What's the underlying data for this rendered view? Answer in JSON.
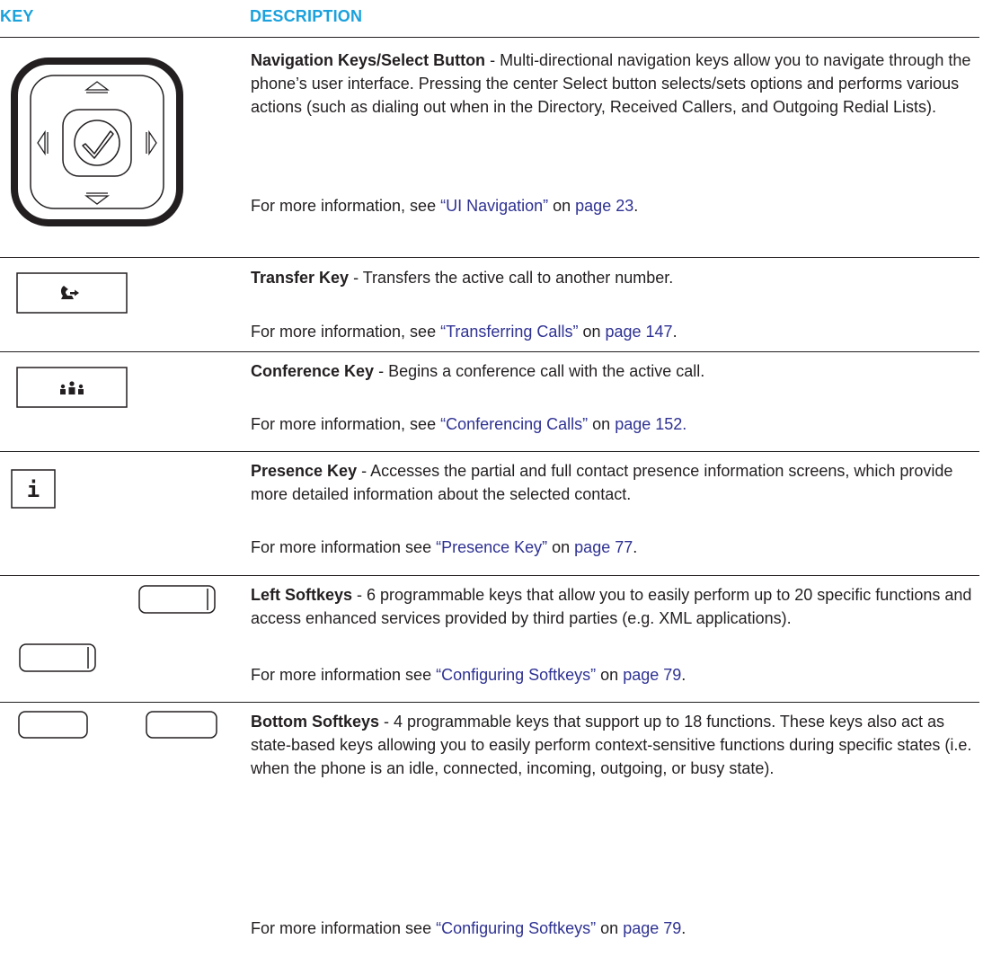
{
  "header": {
    "key_label": "KEY",
    "description_label": "DESCRIPTION"
  },
  "colors": {
    "header_blue": "#1ba1dc",
    "link_blue": "#2e3192",
    "text": "#231f20"
  },
  "rows": [
    {
      "icon": "navigation-keys-select-button-icon",
      "title": "Navigation Keys/Select Button",
      "sep": " - ",
      "description": "Multi-directional navigation keys allow you to navigate through the phone’s user interface. Pressing the center Select button selects/sets options and performs various actions (such as dialing out when in the Directory, Received Callers, and Outgoing Redial Lists).",
      "more_prefix": "For more information, see ",
      "link_text": "“UI Navigation”",
      "more_on": " on ",
      "page_text": "page 23",
      "end": "."
    },
    {
      "icon": "transfer-key-icon",
      "title": "Transfer Key",
      "sep": " - ",
      "description": "Transfers the active call to another number.",
      "more_prefix": "For more information, see ",
      "link_text": "“Transferring Calls”",
      "more_on": " on ",
      "page_text": "page 147",
      "end": "."
    },
    {
      "icon": "conference-key-icon",
      "title": "Conference Key",
      "sep": " - ",
      "description": "Begins a conference call with the active call.",
      "more_prefix": "For more information, see ",
      "link_text": "“Conferencing Calls”",
      "more_on": " on ",
      "page_text": "page 152.",
      "end": ""
    },
    {
      "icon": "presence-key-icon",
      "title": "Presence Key",
      "sep": " - ",
      "description": "Accesses the partial and full contact presence information screens, which provide more detailed information about the selected contact.",
      "more_prefix": "For more information see ",
      "link_text": "“Presence Key”",
      "more_on": " on ",
      "page_text": "page 77",
      "end": "."
    },
    {
      "icon": "left-softkeys-icon",
      "title": "Left Softkeys",
      "sep": " - ",
      "description": "6 programmable keys that allow you to easily perform up to 20 specific functions and access enhanced services provided by third parties (e.g. XML applications).",
      "more_prefix": "For more information see ",
      "link_text": "“Configuring Softkeys”",
      "more_on": " on ",
      "page_text": "page 79",
      "end": "."
    },
    {
      "icon": "bottom-softkeys-icon",
      "title": "Bottom Softkeys",
      "sep": " - ",
      "description": "4 programmable keys that support up to 18 functions. These keys also act as state-based keys allowing you to easily perform context-sensitive functions during specific states (i.e. when the phone is an idle, connected, incoming, outgoing, or busy state).",
      "more_prefix": "For more information see ",
      "link_text": "“Configuring Softkeys”",
      "more_on": " on ",
      "page_text": "page 79",
      "end": "."
    }
  ],
  "icons": {
    "presence_glyph": "i"
  }
}
